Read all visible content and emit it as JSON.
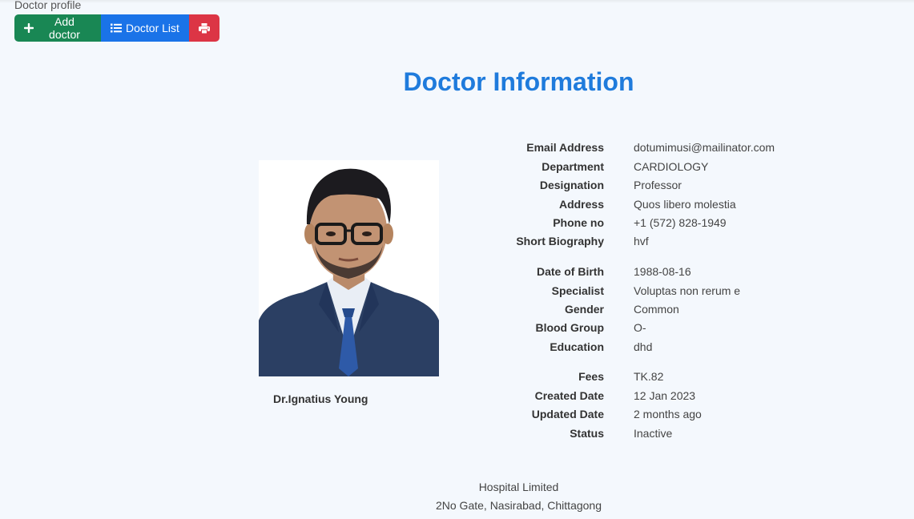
{
  "page": {
    "label": "Doctor profile",
    "title": "Doctor Information"
  },
  "toolbar": {
    "add_label": "Add doctor",
    "list_label": "Doctor List",
    "print_icon": "printer-icon",
    "colors": {
      "add": "#198754",
      "list": "#1a73e8",
      "print": "#dc3545"
    }
  },
  "doctor": {
    "name": "Dr.Ignatius Young"
  },
  "info": [
    {
      "key": "Email Address",
      "value": "dotumimusi@mailinator.com"
    },
    {
      "key": "Department",
      "value": "CARDIOLOGY"
    },
    {
      "key": "Designation",
      "value": "Professor"
    },
    {
      "key": "Address",
      "value": "Quos libero molestia"
    },
    {
      "key": "Phone no",
      "value": "+1 (572) 828-1949"
    },
    {
      "key": "Short Biography",
      "value": "hvf"
    },
    {
      "key": "Date of Birth",
      "value": "1988-08-16"
    },
    {
      "key": "Specialist",
      "value": "Voluptas non rerum e"
    },
    {
      "key": "Gender",
      "value": "Common"
    },
    {
      "key": "Blood Group",
      "value": "O-"
    },
    {
      "key": "Education",
      "value": "dhd"
    },
    {
      "key": "Fees",
      "value": "TK.82"
    },
    {
      "key": "Created Date",
      "value": "12 Jan 2023"
    },
    {
      "key": "Updated Date",
      "value": "2 months ago"
    },
    {
      "key": "Status",
      "value": "Inactive"
    }
  ],
  "footer": {
    "line1": "Hospital Limited",
    "line2": "2No Gate, Nasirabad, Chittagong"
  }
}
